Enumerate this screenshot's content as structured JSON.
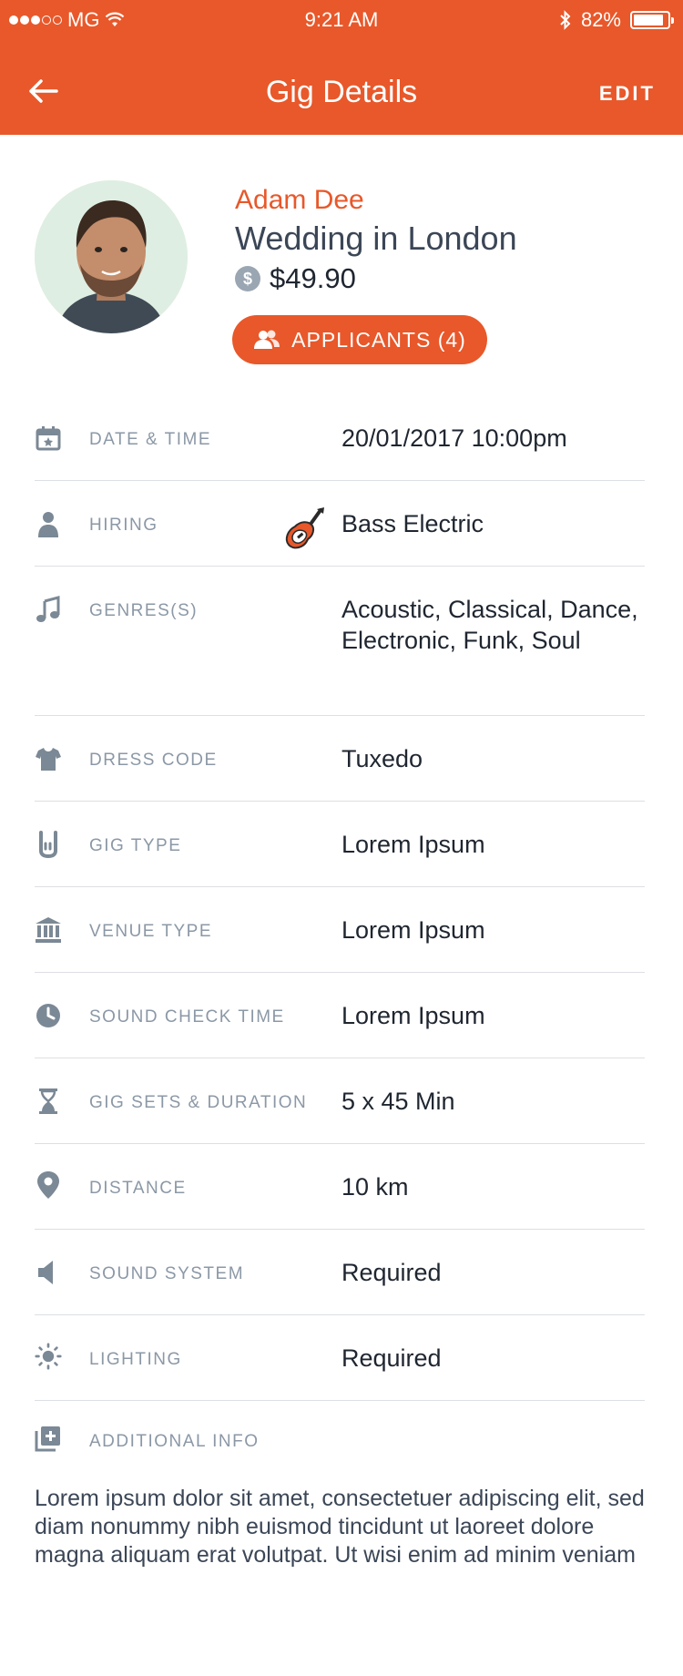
{
  "status_bar": {
    "carrier": "MG",
    "time": "9:21 AM",
    "battery": "82%"
  },
  "navbar": {
    "title": "Gig Details",
    "edit_label": "EDIT"
  },
  "profile": {
    "name": "Adam Dee",
    "gig_title": "Wedding in London",
    "price": "$49.90",
    "applicants_label": "APPLICANTS (4)"
  },
  "details": [
    {
      "label": "DATE & TIME",
      "value": "20/01/2017 10:00pm",
      "icon": "calendar-icon"
    },
    {
      "label": "HIRING",
      "value": "Bass Electric",
      "icon": "person-icon"
    },
    {
      "label": "GENRES(S)",
      "value": "Acoustic, Classical, Dance, Electronic, Funk, Soul",
      "icon": "music-note-icon"
    },
    {
      "label": "DRESS CODE",
      "value": "Tuxedo",
      "icon": "shirt-icon"
    },
    {
      "label": "GIG TYPE",
      "value": "Lorem Ipsum",
      "icon": "rock-hand-icon"
    },
    {
      "label": "VENUE TYPE",
      "value": "Lorem Ipsum",
      "icon": "building-icon"
    },
    {
      "label": "SOUND CHECK TIME",
      "value": "Lorem Ipsum",
      "icon": "clock-icon"
    },
    {
      "label": "GIG SETS & DURATION",
      "value": "5 x 45 Min",
      "icon": "hourglass-icon"
    },
    {
      "label": "DISTANCE",
      "value": "10 km",
      "icon": "location-pin-icon"
    },
    {
      "label": "SOUND SYSTEM",
      "value": "Required",
      "icon": "speaker-icon"
    },
    {
      "label": "LIGHTING",
      "value": "Required",
      "icon": "sun-icon"
    }
  ],
  "additional_info": {
    "label": "ADDITIONAL INFO",
    "text": "Lorem ipsum dolor sit amet, consectetuer adipiscing elit, sed diam nonummy nibh euismod tincidunt ut laoreet dolore magna aliquam erat volutpat. Ut wisi enim ad minim veniam"
  },
  "colors": {
    "accent": "#e8582a",
    "label": "#8b98a6",
    "icon": "#7b8895",
    "divider": "#dcdfe4"
  }
}
